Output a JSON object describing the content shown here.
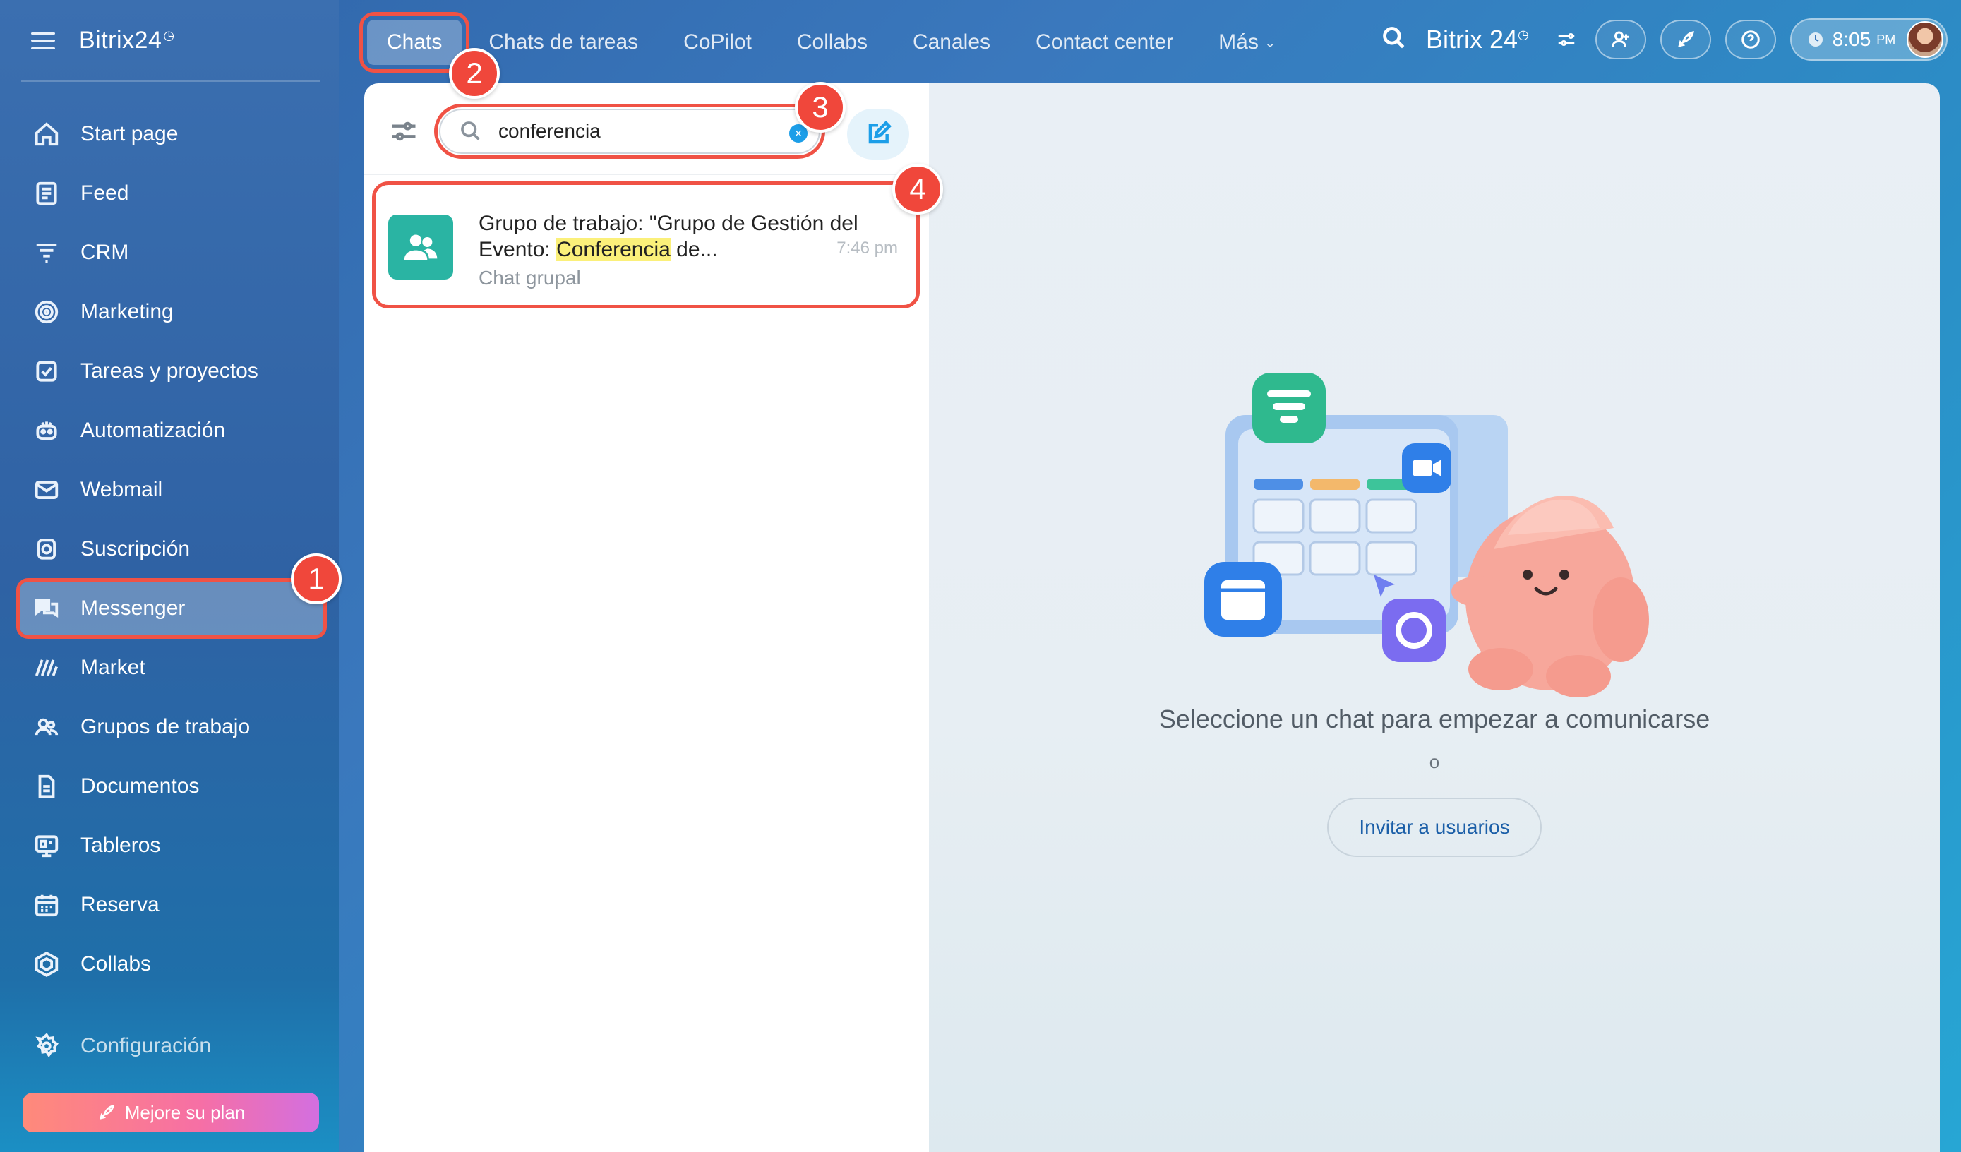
{
  "sidebar": {
    "logo": "Bitrix24",
    "logo_mark": "◷",
    "items": [
      {
        "label": "Start page",
        "icon": "home-icon"
      },
      {
        "label": "Feed",
        "icon": "feed-icon"
      },
      {
        "label": "CRM",
        "icon": "crm-funnel-icon"
      },
      {
        "label": "Marketing",
        "icon": "target-icon"
      },
      {
        "label": "Tareas y proyectos",
        "icon": "checkbox-icon"
      },
      {
        "label": "Automatización",
        "icon": "robot-icon"
      },
      {
        "label": "Webmail",
        "icon": "mail-icon"
      },
      {
        "label": "Suscripción",
        "icon": "subscription-icon"
      },
      {
        "label": "Messenger",
        "icon": "chat-bubbles-icon",
        "active": true
      },
      {
        "label": "Market",
        "icon": "market-icon"
      },
      {
        "label": "Grupos de trabajo",
        "icon": "group-icon"
      },
      {
        "label": "Documentos",
        "icon": "document-icon"
      },
      {
        "label": "Tableros",
        "icon": "board-icon"
      },
      {
        "label": "Reserva",
        "icon": "calendar-icon"
      },
      {
        "label": "Collabs",
        "icon": "hexagon-icon"
      }
    ],
    "settings_label": "Configuración",
    "upgrade_label": "Mejore su plan"
  },
  "topbar": {
    "tabs": [
      "Chats",
      "Chats de tareas",
      "CoPilot",
      "Collabs",
      "Canales",
      "Contact center",
      "Más"
    ],
    "logo": "Bitrix 24",
    "time": "8:05",
    "ampm": "PM"
  },
  "search": {
    "value": "conferencia",
    "placeholder": ""
  },
  "chat_results": [
    {
      "title_before": "Grupo de trabajo: \"Grupo de Gestión del Evento: ",
      "title_highlight": "Conferencia",
      "title_after": " de...",
      "time": "7:46 pm",
      "subtitle": "Chat grupal"
    }
  ],
  "empty_state": {
    "title": "Seleccione un chat para empezar a comunicarse",
    "or": "o",
    "invite_label": "Invitar a usuarios"
  },
  "annotations": [
    "1",
    "2",
    "3",
    "4"
  ],
  "colors": {
    "accent_red": "#f05245",
    "brand_blue": "#1c9ee8",
    "group_teal": "#2ab4a3",
    "highlight": "#fbf07a"
  }
}
